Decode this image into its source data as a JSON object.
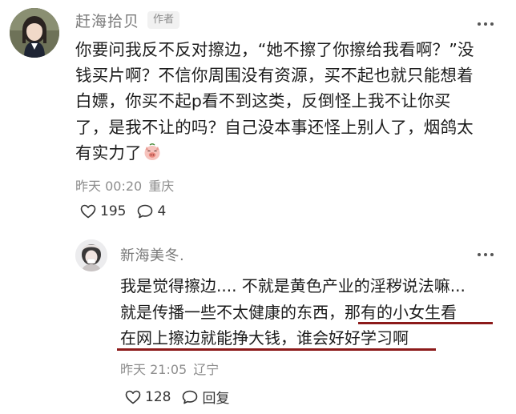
{
  "comment": {
    "author": "赶海拾贝",
    "badge": "作者",
    "text_lines": [
      "你要问我反不反对擦边，“她不擦了你擦给我看啊？”没",
      "钱买片啊？不信你周围没有资源，买不起也就只能想着",
      "白嫖，你买不起p看不到这类，反倒怪上我不让你买",
      "了，是我不让的吗？自己没本事还怪上别人了，烟鸽太",
      "有实力了"
    ],
    "emoji_icon": "pig-face-emoji-icon",
    "time": "昨天 00:20",
    "location": "重庆",
    "likes": "195",
    "replies": "4"
  },
  "reply": {
    "author": "新海美冬.",
    "text_lines": [
      "我是觉得擦边.... 不就是黄色产业的淫秽说法嘛...",
      "就是传播一些不太健康的东西，",
      "那有的小女生看",
      "在网上擦边就能挣大钱，谁会好好学习啊"
    ],
    "time": "昨天 21:05",
    "location": "辽宁",
    "likes": "128",
    "reply_label": "回复"
  },
  "colors": {
    "underline": "#8c1a1a",
    "meta_text": "#8d8d8d",
    "name_text": "#7a7a7a"
  }
}
